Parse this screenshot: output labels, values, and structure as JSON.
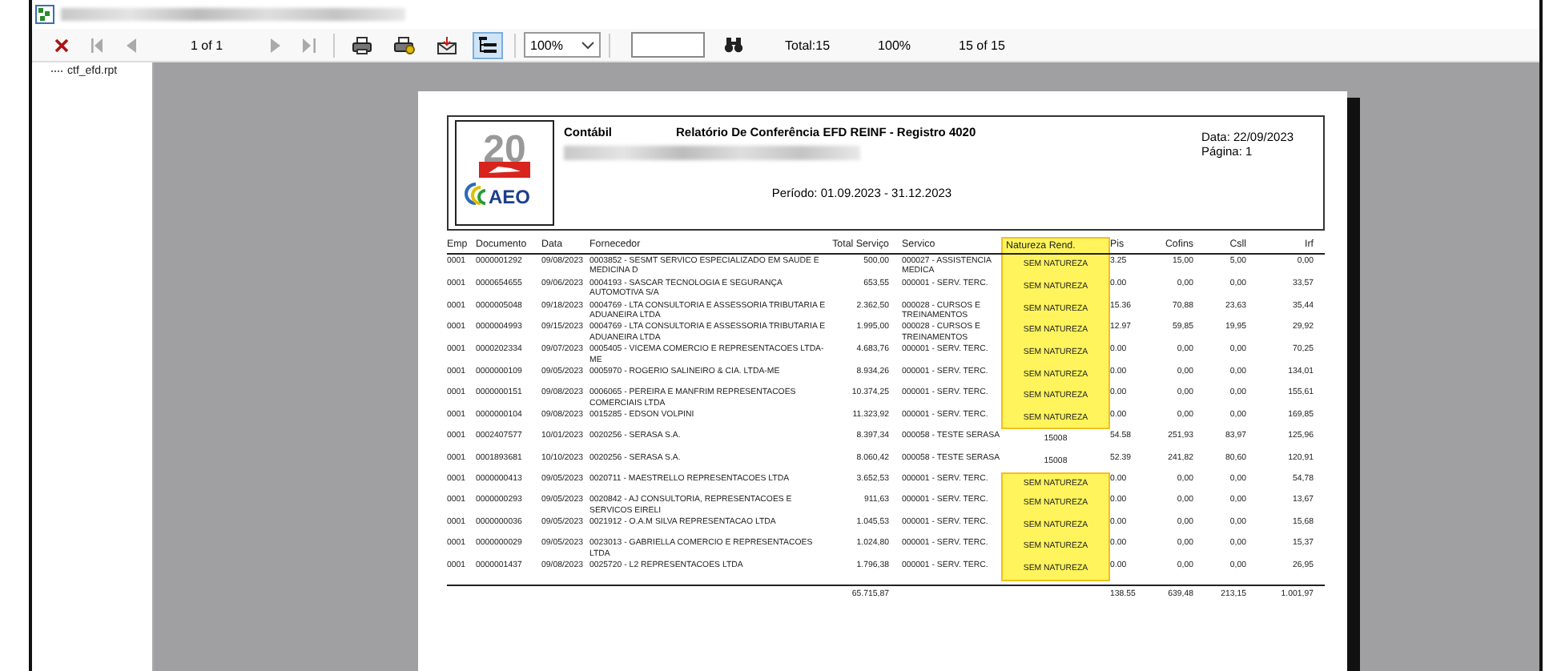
{
  "toolbar": {
    "page_indicator": "1 of 1",
    "zoom": "100%",
    "tree_toggle_on": true,
    "status": [
      "Total:15",
      "100%",
      "15 of 15"
    ]
  },
  "tree": {
    "items": [
      {
        "label": "ctf_efd.rpt",
        "selected": false
      }
    ]
  },
  "report": {
    "logo": {
      "number": "20",
      "mark": "AEO"
    },
    "company": "Contábil",
    "title": "Relatório De Conferência EFD REINF - Registro 4020",
    "date": "Data: 22/09/2023",
    "page": "Página: 1",
    "period": "Período: 01.09.2023 - 31.12.2023",
    "columns": [
      {
        "label": "Emp",
        "highlighted": false
      },
      {
        "label": "Documento",
        "highlighted": false
      },
      {
        "label": "Data",
        "highlighted": false
      },
      {
        "label": "Fornecedor",
        "highlighted": false
      },
      {
        "label": "Total Serviço",
        "highlighted": false
      },
      {
        "label": "Servico",
        "highlighted": false
      },
      {
        "label": "Natureza Rend.",
        "highlighted": true
      },
      {
        "label": "Pis",
        "highlighted": false
      },
      {
        "label": "Cofins",
        "highlighted": false
      },
      {
        "label": "Csll",
        "highlighted": false
      },
      {
        "label": "Irf",
        "highlighted": false
      }
    ],
    "rows": [
      {
        "cells": [
          "0001",
          "0000001292",
          "09/08/2023",
          "0003852 - SESMT SERVICO ESPECIALIZADO EM SAUDE E MEDICINA D",
          "500,00",
          "000027 - ASSISTENCIA MEDICA",
          "SEM NATUREZA",
          "3.25",
          "15,00",
          "5,00",
          "0,00"
        ],
        "highlighted": true
      },
      {
        "cells": [
          "0001",
          "0000654655",
          "09/06/2023",
          "0004193 - SASCAR TECNOLOGIA E SEGURANÇA AUTOMOTIVA S/A",
          "653,55",
          "000001 - SERV. TERC.",
          "SEM NATUREZA",
          "0.00",
          "0,00",
          "0,00",
          "33,57"
        ],
        "highlighted": true
      },
      {
        "cells": [
          "0001",
          "0000005048",
          "09/18/2023",
          "0004769 - LTA CONSULTORIA E ASSESSORIA TRIBUTARIA E ADUANEIRA LTDA",
          "2.362,50",
          "000028 - CURSOS E TREINAMENTOS",
          "SEM NATUREZA",
          "15.36",
          "70,88",
          "23,63",
          "35,44"
        ],
        "highlighted": true
      },
      {
        "cells": [
          "0001",
          "0000004993",
          "09/15/2023",
          "0004769 - LTA CONSULTORIA E ASSESSORIA TRIBUTARIA E ADUANEIRA LTDA",
          "1.995,00",
          "000028 - CURSOS E TREINAMENTOS",
          "SEM NATUREZA",
          "12.97",
          "59,85",
          "19,95",
          "29,92"
        ],
        "highlighted": true
      },
      {
        "cells": [
          "0001",
          "0000202334",
          "09/07/2023",
          "0005405 - VICEMA COMERCIO E REPRESENTACOES LTDA-ME",
          "4.683,76",
          "000001 - SERV. TERC.",
          "SEM NATUREZA",
          "0.00",
          "0,00",
          "0,00",
          "70,25"
        ],
        "highlighted": true
      },
      {
        "cells": [
          "0001",
          "0000000109",
          "09/05/2023",
          "0005970 - ROGERIO SALINEIRO & CIA. LTDA-ME",
          "8.934,26",
          "000001 - SERV. TERC.",
          "SEM NATUREZA",
          "0.00",
          "0,00",
          "0,00",
          "134,01"
        ],
        "highlighted": true
      },
      {
        "cells": [
          "0001",
          "0000000151",
          "09/08/2023",
          "0006065 - PEREIRA E MANFRIM REPRESENTACOES COMERCIAIS LTDA",
          "10.374,25",
          "000001 - SERV. TERC.",
          "SEM NATUREZA",
          "0.00",
          "0,00",
          "0,00",
          "155,61"
        ],
        "highlighted": true
      },
      {
        "cells": [
          "0001",
          "0000000104",
          "09/08/2023",
          "0015285 - EDSON VOLPINI",
          "11.323,92",
          "000001 - SERV. TERC.",
          "SEM NATUREZA",
          "0.00",
          "0,00",
          "0,00",
          "169,85"
        ],
        "highlighted": true
      },
      {
        "cells": [
          "0001",
          "0002407577",
          "10/01/2023",
          "0020256 - SERASA S.A.",
          "8.397,34",
          "000058 - TESTE SERASA",
          "15008",
          "54.58",
          "251,93",
          "83,97",
          "125,96"
        ],
        "highlighted": false
      },
      {
        "cells": [
          "0001",
          "0001893681",
          "10/10/2023",
          "0020256 - SERASA S.A.",
          "8.060,42",
          "000058 - TESTE SERASA",
          "15008",
          "52.39",
          "241,82",
          "80,60",
          "120,91"
        ],
        "highlighted": false
      },
      {
        "cells": [
          "0001",
          "0000000413",
          "09/05/2023",
          "0020711 - MAESTRELLO REPRESENTACOES LTDA",
          "3.652,53",
          "000001 - SERV. TERC.",
          "SEM NATUREZA",
          "0.00",
          "0,00",
          "0,00",
          "54,78"
        ],
        "highlighted": true
      },
      {
        "cells": [
          "0001",
          "0000000293",
          "09/05/2023",
          "0020842 - AJ CONSULTORIA, REPRESENTACOES E SERVICOS EIRELI",
          "911,63",
          "000001 - SERV. TERC.",
          "SEM NATUREZA",
          "0.00",
          "0,00",
          "0,00",
          "13,67"
        ],
        "highlighted": true
      },
      {
        "cells": [
          "0001",
          "0000000036",
          "09/05/2023",
          "0021912 - O.A.M SILVA REPRESENTACAO LTDA",
          "1.045,53",
          "000001 - SERV. TERC.",
          "SEM NATUREZA",
          "0.00",
          "0,00",
          "0,00",
          "15,68"
        ],
        "highlighted": true
      },
      {
        "cells": [
          "0001",
          "0000000029",
          "09/05/2023",
          "0023013 - GABRIELLA COMERCIO E REPRESENTACOES LTDA",
          "1.024,80",
          "000001 - SERV. TERC.",
          "SEM NATUREZA",
          "0.00",
          "0,00",
          "0,00",
          "15,37"
        ],
        "highlighted": true
      },
      {
        "cells": [
          "0001",
          "0000001437",
          "09/08/2023",
          "0025720 - L2 REPRESENTACOES LTDA",
          "1.796,38",
          "000001 - SERV. TERC.",
          "SEM NATUREZA",
          "0.00",
          "0,00",
          "0,00",
          "26,95"
        ],
        "highlighted": true
      }
    ],
    "totals": {
      "total_servico": "65.715,87",
      "pis": "138.55",
      "cofins": "639,48",
      "csll": "213,15",
      "irf": "1.001,97"
    }
  }
}
